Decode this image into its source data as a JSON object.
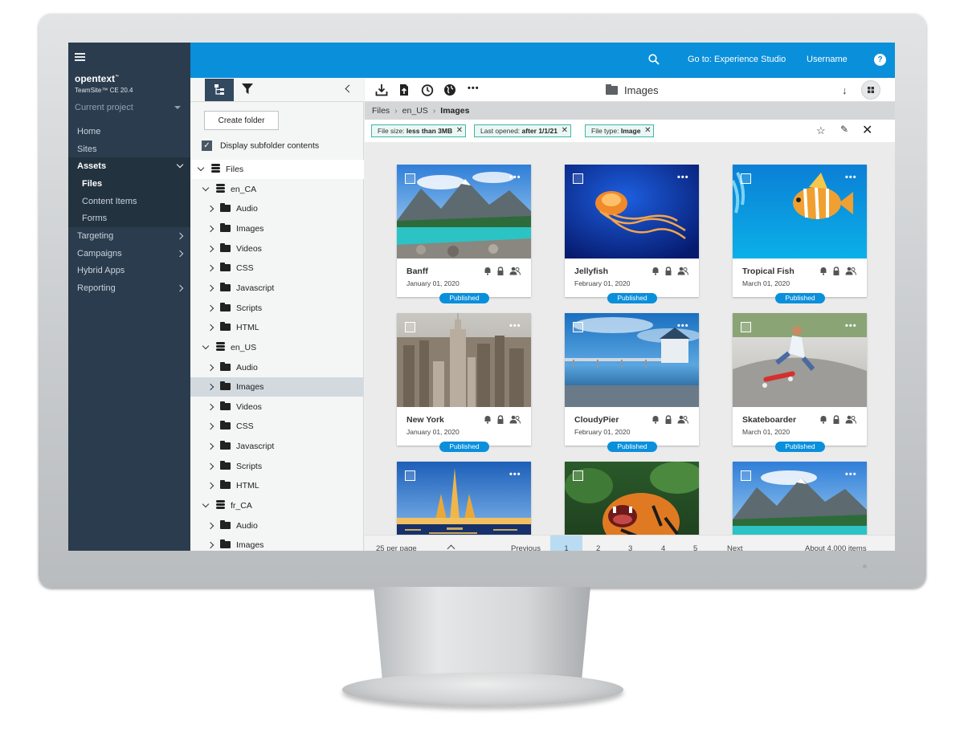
{
  "app": {
    "logo": "opentext",
    "logo_mark": "™",
    "product": "TeamSite™ CE 20.4",
    "current_project": "Current project"
  },
  "nav": {
    "items": [
      {
        "label": "Home"
      },
      {
        "label": "Sites"
      },
      {
        "label": "Assets"
      },
      {
        "label": "Files"
      },
      {
        "label": "Content Items"
      },
      {
        "label": "Forms"
      },
      {
        "label": "Targeting"
      },
      {
        "label": "Campaigns"
      },
      {
        "label": "Hybrid Apps"
      },
      {
        "label": "Reporting"
      }
    ]
  },
  "topbar": {
    "goto": "Go to: Experience Studio",
    "username": "Username",
    "help": "?"
  },
  "tree": {
    "create_folder": "Create folder",
    "display_subfolders": "Display subfolder contents",
    "check_mark": "✓",
    "rows": [
      {
        "label": "Files"
      },
      {
        "label": "en_CA"
      },
      {
        "label": "Audio"
      },
      {
        "label": "Images"
      },
      {
        "label": "Videos"
      },
      {
        "label": "CSS"
      },
      {
        "label": "Javascript"
      },
      {
        "label": "Scripts"
      },
      {
        "label": "HTML"
      },
      {
        "label": "en_US"
      },
      {
        "label": "Audio"
      },
      {
        "label": "Images"
      },
      {
        "label": "Videos"
      },
      {
        "label": "CSS"
      },
      {
        "label": "Javascript"
      },
      {
        "label": "Scripts"
      },
      {
        "label": "HTML"
      },
      {
        "label": "fr_CA"
      },
      {
        "label": "Audio"
      },
      {
        "label": "Images"
      }
    ]
  },
  "content": {
    "title": "Images",
    "more": "•••",
    "sort_arrow": "↓",
    "breadcrumb": [
      "Files",
      "en_US",
      "Images"
    ],
    "breadcrumb_sep": "›",
    "filters": [
      {
        "key": "File size:",
        "value": "less than 3MB"
      },
      {
        "key": "Last opened:",
        "value": "after 1/1/21"
      },
      {
        "key": "File type:",
        "value": "Image"
      }
    ],
    "chip_close": "✕",
    "actions": {
      "star": "☆",
      "edit": "✎",
      "close": "✕"
    }
  },
  "cards": [
    {
      "name": "Banff",
      "date": "January 01, 2020",
      "status": "Published",
      "more": "•••"
    },
    {
      "name": "Jellyfish",
      "date": "February 01, 2020",
      "status": "Published",
      "more": "•••"
    },
    {
      "name": "Tropical Fish",
      "date": "March 01, 2020",
      "status": "Published",
      "more": "•••"
    },
    {
      "name": "New York",
      "date": "January 01, 2020",
      "status": "Published",
      "more": "•••"
    },
    {
      "name": "CloudyPier",
      "date": "February 01, 2020",
      "status": "Published",
      "more": "•••"
    },
    {
      "name": "Skateboarder",
      "date": "March 01, 2020",
      "status": "Published",
      "more": "•••"
    },
    {
      "name": "",
      "date": "",
      "status": "",
      "more": "•••"
    },
    {
      "name": "",
      "date": "",
      "status": "",
      "more": ""
    },
    {
      "name": "",
      "date": "",
      "status": "",
      "more": "•••"
    }
  ],
  "pager": {
    "per_page": "25 per page",
    "previous": "Previous",
    "pages": [
      "1",
      "2",
      "3",
      "4",
      "5"
    ],
    "current_page": 1,
    "next": "Next",
    "total": "About 4,000 items"
  },
  "colors": {
    "accent": "#0a8fdb",
    "nav_bg": "#2b3c4e",
    "chip_border": "#3fb7a4"
  }
}
